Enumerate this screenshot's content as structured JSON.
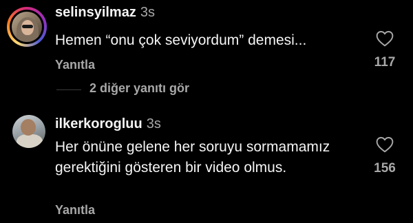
{
  "comments": [
    {
      "username": "selinsyilmaz",
      "time": "3s",
      "text": "Hemen “onu çok seviyordum” demesi...",
      "reply_label": "Yanıtla",
      "likes": "117"
    },
    {
      "username": "ilkerkorogluu",
      "time": "3s",
      "text": "Her önüne gelene her soruyu sormamamız gerektiğini gösteren bir video olmus.",
      "reply_label": "Yanıtla",
      "likes": "156"
    }
  ],
  "view_more_replies": "2 diğer yanıtı gör",
  "colors": {
    "background": "#000000",
    "primary_text": "#f5f5f5",
    "secondary_text": "#a8a8a8"
  },
  "icons": {
    "like": "heart-outline-icon"
  }
}
